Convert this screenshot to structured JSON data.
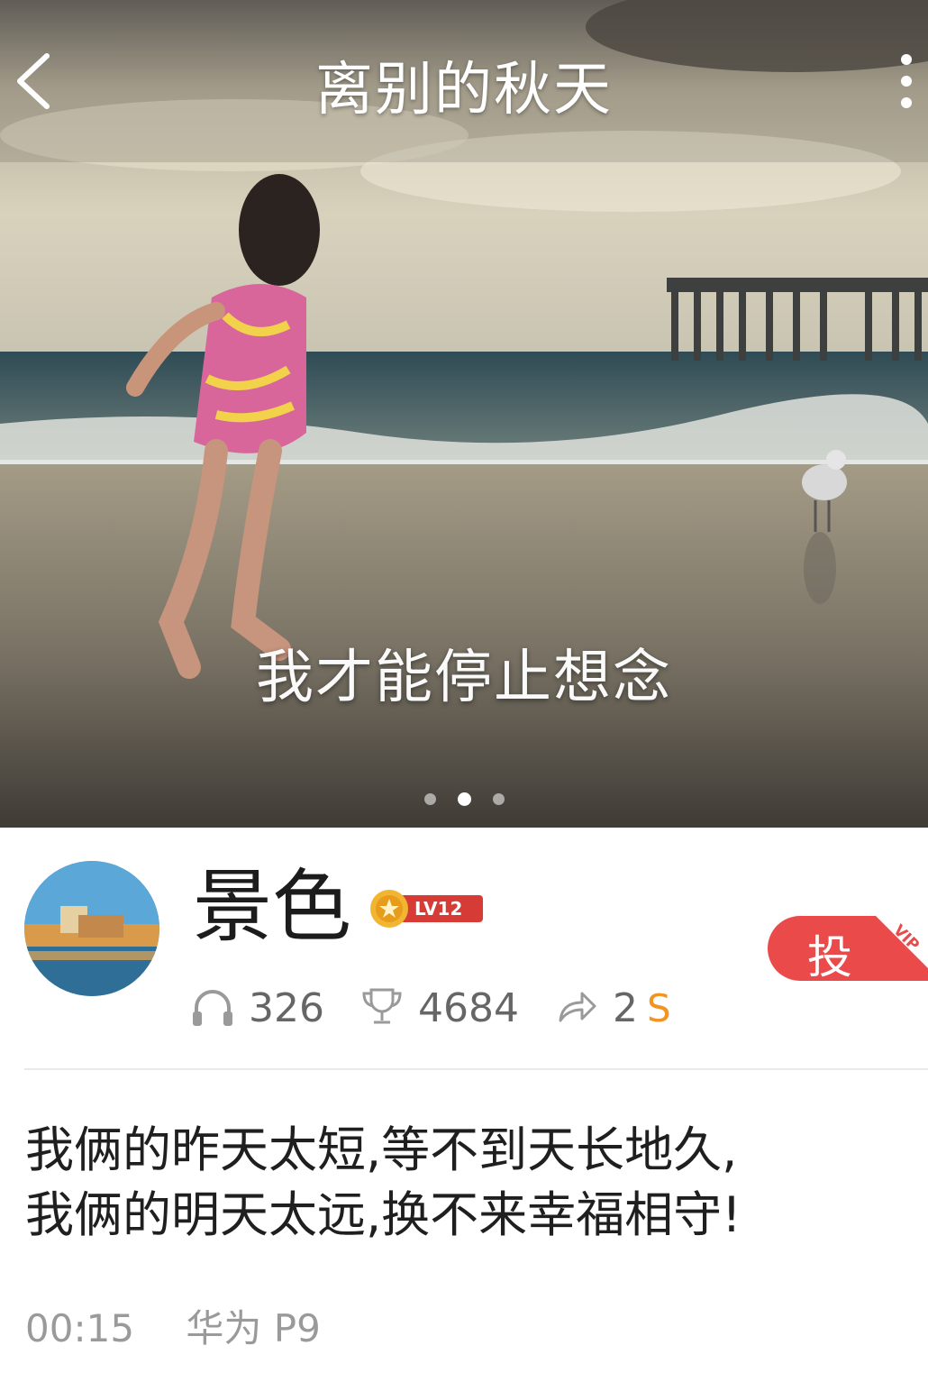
{
  "header": {
    "title": "离别的秋天",
    "back_icon": "chevron-left-icon",
    "more_icon": "more-vertical-icon"
  },
  "hero": {
    "caption": "我才能停止想念",
    "slides_total": 3,
    "active_slide": 2
  },
  "profile": {
    "username": "景色",
    "level_badge": "LV12",
    "stats": {
      "listens": "326",
      "trophies": "4684",
      "shares": "2",
      "s_badge": "S"
    },
    "vote_button": "投",
    "vip_tag": "VIP"
  },
  "post": {
    "line1": "我俩的昨天太短,等不到天长地久,",
    "line2": "我俩的明天太远,换不来幸福相守!"
  },
  "meta": {
    "time": "00:15",
    "device": "华为 P9"
  },
  "colors": {
    "vote_red": "#ea4a4a",
    "s_orange": "#f39320",
    "level_red": "#d73b36"
  }
}
